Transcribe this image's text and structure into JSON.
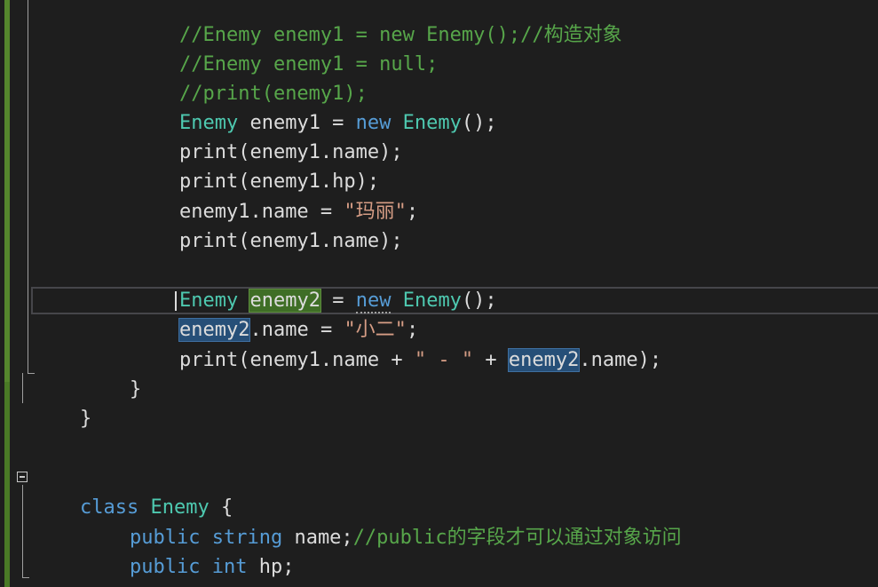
{
  "colors": {
    "background": "#1e1e1e",
    "comment": "#57a64a",
    "keyword": "#569cd6",
    "type": "#4ec9b0",
    "string": "#d69d85",
    "plain": "#dcdcdc",
    "highlight_definition": "#3f6e26",
    "highlight_reference": "#264f78",
    "change_bar": "#55862d"
  },
  "code": {
    "line0": {
      "comment": "//Enemy enemy1 = new Enemy();//构造对象"
    },
    "line1": {
      "comment": "//Enemy enemy1 = null;"
    },
    "line2": {
      "comment": "//print(enemy1);"
    },
    "line3": {
      "type": "Enemy",
      "mid": " enemy1 = ",
      "kw": "new",
      "sp": " ",
      "type2": "Enemy",
      "end": "();"
    },
    "line4": {
      "text": "print(enemy1.name);"
    },
    "line5": {
      "text": "print(enemy1.hp);"
    },
    "line6": {
      "pre": "enemy1.name = ",
      "str": "\"玛丽\"",
      "end": ";"
    },
    "line7": {
      "text": "print(enemy1.name);"
    },
    "line8": {
      "type": "Enemy",
      "sp1": " ",
      "var": "enemy2",
      "mid": " = ",
      "kw": "new",
      "sp2": " ",
      "type2": "Enemy",
      "end": "();"
    },
    "line9": {
      "var": "enemy2",
      "mid": ".name = ",
      "str": "\"小二\"",
      "end": ";"
    },
    "line10": {
      "pre": "print(enemy1.name + ",
      "str": "\" - \"",
      "mid": " + ",
      "var": "enemy2",
      "end": ".name);"
    },
    "line11": {
      "text": "}"
    },
    "line12": {
      "text": "}"
    },
    "line13": {
      "kw": "class",
      "sp": " ",
      "type": "Enemy",
      "end": " {"
    },
    "line14": {
      "kw1": "public",
      "sp1": " ",
      "kw2": "string",
      "mid": " name;",
      "comment": "//public的字段才可以通过对象访问"
    },
    "line15": {
      "kw1": "public",
      "sp1": " ",
      "kw2": "int",
      "end": " hp;"
    },
    "line16": {
      "text": "}"
    }
  },
  "icons": {
    "collapse": "collapse-minus-icon"
  }
}
